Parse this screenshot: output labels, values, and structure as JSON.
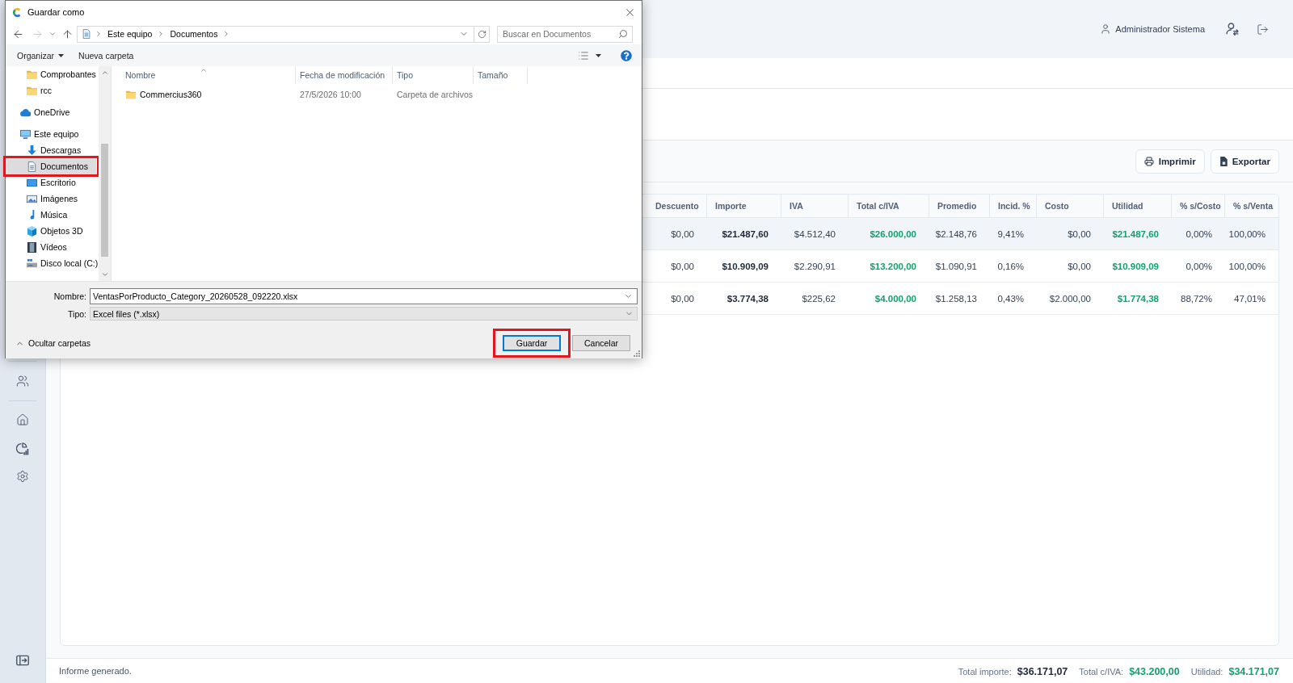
{
  "dialog": {
    "title": "Guardar como",
    "nav_buttons": [
      {
        "kind": "back",
        "disabled": false
      },
      {
        "kind": "forward",
        "disabled": true
      },
      {
        "kind": "recent",
        "disabled": false
      },
      {
        "kind": "up",
        "disabled": false
      }
    ],
    "breadcrumb": [
      "Este equipo",
      "Documentos"
    ],
    "search": {
      "placeholder": "Buscar en Documentos"
    },
    "commands": [
      {
        "label": "Organizar",
        "menu": true
      },
      {
        "label": "Nueva carpeta",
        "menu": false
      }
    ],
    "nav_tree": [
      {
        "children": [
          {
            "label": "Comprobantes",
            "kind": "folder",
            "selected": false,
            "highlighted": false
          },
          {
            "label": "rcc",
            "kind": "folder",
            "selected": false,
            "highlighted": false
          }
        ]
      },
      {
        "label": "OneDrive",
        "kind": "cloud",
        "selected": false,
        "highlighted": false
      },
      {
        "label": "Este equipo",
        "kind": "computer",
        "selected": false,
        "highlighted": false,
        "children": [
          {
            "label": "Descargas",
            "kind": "downloads",
            "selected": false,
            "highlighted": false
          },
          {
            "label": "Documentos",
            "kind": "documents",
            "selected": true,
            "highlighted": true
          },
          {
            "label": "Escritorio",
            "kind": "desktop",
            "selected": false,
            "highlighted": false
          },
          {
            "label": "Imágenes",
            "kind": "pictures",
            "selected": false,
            "highlighted": false
          },
          {
            "label": "Música",
            "kind": "music",
            "selected": false,
            "highlighted": false
          },
          {
            "label": "Objetos 3D",
            "kind": "objects",
            "selected": false,
            "highlighted": false
          },
          {
            "label": "Vídeos",
            "kind": "videos",
            "selected": false,
            "highlighted": false
          },
          {
            "label": "Disco local (C:)",
            "kind": "drive",
            "selected": false,
            "highlighted": false
          }
        ]
      }
    ],
    "columns": [
      {
        "label": "Nombre",
        "sorted": true
      },
      {
        "label": "Fecha de modificación",
        "sorted": false
      },
      {
        "label": "Tipo",
        "sorted": false
      },
      {
        "label": "Tamaño",
        "sorted": false
      }
    ],
    "files": [
      {
        "name": "Commercius360",
        "modified": "27/5/2026 10:00",
        "type": "Carpeta de archivos"
      }
    ],
    "filename": {
      "label": "Nombre:",
      "value": "VentasPorProducto_Category_20260528_092220.xlsx"
    },
    "filetype": {
      "label": "Tipo:",
      "value": "Excel files (*.xlsx)"
    },
    "hide_folders": "Ocultar carpetas",
    "buttons": [
      {
        "label": "Guardar",
        "default": true,
        "highlighted": true
      },
      {
        "label": "Cancelar",
        "default": false,
        "highlighted": false
      }
    ]
  },
  "header": {
    "user": "Administrador Sistema"
  },
  "toolbar": {
    "buttons": [
      {
        "label": "Imprimir",
        "kind": "print"
      },
      {
        "label": "Exportar",
        "kind": "export"
      }
    ]
  },
  "table": {
    "columns": [
      {
        "label": "Descuento",
        "kind": "plain"
      },
      {
        "label": "Importe",
        "kind": "bold"
      },
      {
        "label": "IVA",
        "kind": "plain"
      },
      {
        "label": "Total c/IVA",
        "kind": "profit"
      },
      {
        "label": "Promedio",
        "kind": "plain"
      },
      {
        "label": "Incid. %",
        "kind": "plain"
      },
      {
        "label": "Costo",
        "kind": "plain"
      },
      {
        "label": "Utilidad",
        "kind": "profit"
      },
      {
        "label": "% s/Costo",
        "kind": "plain"
      },
      {
        "label": "% s/Venta",
        "kind": "plain"
      }
    ],
    "rows": [
      {
        "selected": true,
        "cells": [
          "$0,00",
          "$21.487,60",
          "$4.512,40",
          "$26.000,00",
          "$2.148,76",
          "9,41%",
          "$0,00",
          "$21.487,60",
          "0,00%",
          "100,00%"
        ]
      },
      {
        "selected": false,
        "cells": [
          "$0,00",
          "$10.909,09",
          "$2.290,91",
          "$13.200,00",
          "$1.090,91",
          "0,16%",
          "$0,00",
          "$10.909,09",
          "0,00%",
          "100,00%"
        ]
      },
      {
        "selected": false,
        "cells": [
          "$0,00",
          "$3.774,38",
          "$225,62",
          "$4.000,00",
          "$1.258,13",
          "0,43%",
          "$2.000,00",
          "$1.774,38",
          "88,72%",
          "47,01%"
        ]
      }
    ]
  },
  "status_bar": {
    "message": "Informe generado.",
    "totals": [
      {
        "label": "Total importe:",
        "value": "$36.171,07",
        "kind": "bold"
      },
      {
        "label": "Total c/IVA:",
        "value": "$43.200,00",
        "kind": "profit"
      },
      {
        "label": "Utilidad:",
        "value": "$34.171,07",
        "kind": "profit"
      }
    ]
  }
}
